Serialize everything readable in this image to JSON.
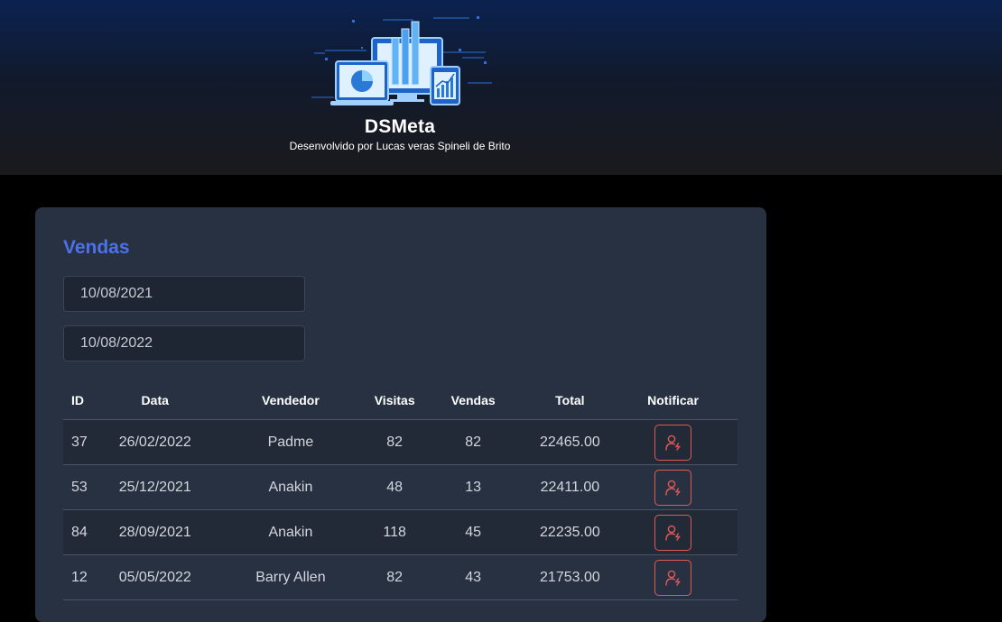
{
  "header": {
    "title": "DSMeta",
    "subtitle": "Desenvolvido por Lucas veras Spineli de Brito"
  },
  "sales": {
    "title": "Vendas",
    "min_date": "10/08/2021",
    "max_date": "10/08/2022",
    "columns": [
      "ID",
      "Data",
      "Vendedor",
      "Visitas",
      "Vendas",
      "Total",
      "Notificar"
    ],
    "rows": [
      {
        "id": "37",
        "date": "26/02/2022",
        "seller": "Padme",
        "visits": "82",
        "deals": "82",
        "total": "22465.00"
      },
      {
        "id": "53",
        "date": "25/12/2021",
        "seller": "Anakin",
        "visits": "48",
        "deals": "13",
        "total": "22411.00"
      },
      {
        "id": "84",
        "date": "28/09/2021",
        "seller": "Anakin",
        "visits": "118",
        "deals": "45",
        "total": "22235.00"
      },
      {
        "id": "12",
        "date": "05/05/2022",
        "seller": "Barry Allen",
        "visits": "82",
        "deals": "43",
        "total": "21753.00"
      }
    ]
  },
  "colors": {
    "accent": "#4d71e8",
    "notify": "#e05a55",
    "card": "#283142"
  },
  "icons": {
    "logo": "dashboard-illustration",
    "notify": "user-notify-icon"
  }
}
